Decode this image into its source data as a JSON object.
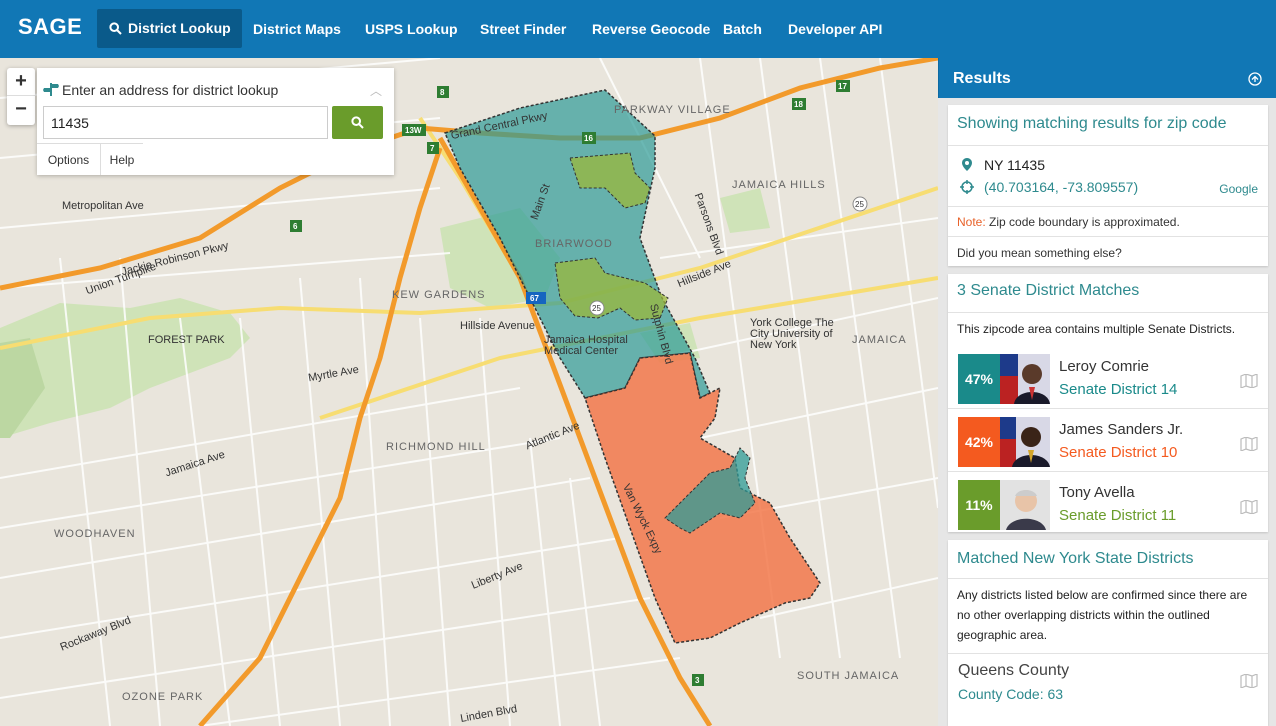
{
  "app": {
    "brand": "SAGE",
    "nav": [
      {
        "label": "District Lookup",
        "active": true
      },
      {
        "label": "District Maps"
      },
      {
        "label": "USPS Lookup"
      },
      {
        "label": "Street Finder"
      },
      {
        "label": "Reverse Geocode"
      },
      {
        "label": "Batch"
      },
      {
        "label": "Developer API"
      }
    ],
    "colors": {
      "nav_bg": "#1177b5",
      "accent_teal": "#2e8a8e",
      "green": "#6a9c2b",
      "orange": "#e8622a"
    }
  },
  "lookup": {
    "title": "Enter an address for district lookup",
    "input_value": "11435",
    "options_label": "Options",
    "help_label": "Help"
  },
  "map": {
    "zoom_in": "+",
    "zoom_out": "−",
    "areas": [
      "PARKWAY VILLAGE",
      "JAMAICA HILLS",
      "BRIARWOOD",
      "KEW GARDENS",
      "FOREST PARK",
      "RICHMOND HILL",
      "WOODHAVEN",
      "OZONE PARK",
      "SOUTH JAMAICA",
      "JAMAICA"
    ],
    "roads": [
      "Grand Central Pkwy",
      "Jackie Robinson Pkwy",
      "Union Turnpike",
      "Hillside Avenue",
      "Atlantic Ave",
      "Jamaica Ave",
      "Liberty Ave",
      "Rockaway Blvd",
      "Metropolitan Ave",
      "Myrtle Ave",
      "Hillside Ave",
      "Van Wyck Expy",
      "Sutphin Blvd",
      "Main St",
      "Parsons Blvd",
      "Linden Blvd"
    ],
    "pois": [
      "Jamaica Hospital Medical Center",
      "York College The City University of New York"
    ],
    "shields": [
      "13W",
      "8",
      "7",
      "18",
      "17",
      "16",
      "6",
      "25",
      "67",
      "3"
    ]
  },
  "results": {
    "title": "Results",
    "zip_card": {
      "heading": "Showing matching results for zip code",
      "zip": "NY 11435",
      "coords": "(40.703164, -73.809557)",
      "geocoder": "Google",
      "note_label": "Note:",
      "note_text": " Zip code boundary is approximated.",
      "suggest": "Did you mean something else?"
    },
    "senate_card": {
      "heading": "3 Senate District Matches",
      "description": "This zipcode area contains multiple Senate Districts.",
      "senators": [
        {
          "pct": "47%",
          "name": "Leroy Comrie",
          "district": "Senate District 14",
          "color": "#1a8a8a"
        },
        {
          "pct": "42%",
          "name": "James Sanders Jr.",
          "district": "Senate District 10",
          "color": "#f45a1f"
        },
        {
          "pct": "11%",
          "name": "Tony Avella",
          "district": "Senate District 11",
          "color": "#6a9c2b"
        }
      ]
    },
    "nys_card": {
      "heading": "Matched New York State Districts",
      "description": "Any districts listed below are confirmed since there are no other overlapping districts within the outlined geographic area.",
      "county_name": "Queens County",
      "county_code": "County Code: 63"
    }
  }
}
